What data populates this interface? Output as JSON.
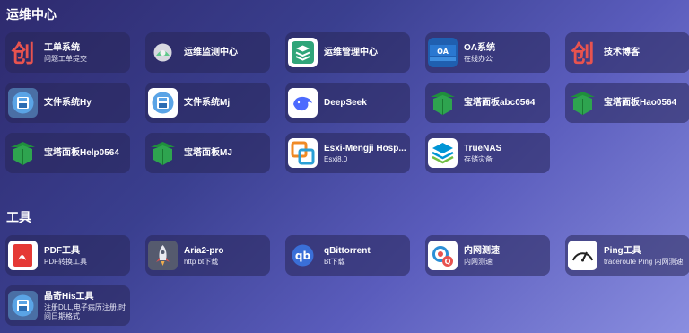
{
  "sections": [
    {
      "title": "运维中心",
      "cards": [
        {
          "name": "工单系统",
          "desc": "问题工单提交",
          "icon": "chuang-logo-icon"
        },
        {
          "name": "运维监测中心",
          "desc": "",
          "icon": "monitor-app-icon"
        },
        {
          "name": "运维管理中心",
          "desc": "",
          "icon": "stack-layers-icon"
        },
        {
          "name": "OA系统",
          "desc": "在线办公",
          "icon": "oa-logo-icon"
        },
        {
          "name": "技术博客",
          "desc": "",
          "icon": "chuang-logo-icon"
        },
        {
          "name": "文件系统Hy",
          "desc": "",
          "icon": "floppy-disk-icon"
        },
        {
          "name": "文件系统Mj",
          "desc": "",
          "icon": "floppy-disk-icon"
        },
        {
          "name": "DeepSeek",
          "desc": "",
          "icon": "whale-icon"
        },
        {
          "name": "宝塔面板abc0564",
          "desc": "",
          "icon": "pagoda-icon"
        },
        {
          "name": "宝塔面板Hao0564",
          "desc": "",
          "icon": "pagoda-icon"
        },
        {
          "name": "宝塔面板Help0564",
          "desc": "",
          "icon": "pagoda-icon"
        },
        {
          "name": "宝塔面板MJ",
          "desc": "",
          "icon": "pagoda-icon"
        },
        {
          "name": "Esxi-Mengji Hosp...",
          "desc": "Esxi8.0",
          "icon": "vmware-icon"
        },
        {
          "name": "TrueNAS",
          "desc": "存储灾备",
          "icon": "truenas-icon"
        }
      ]
    },
    {
      "title": "工具",
      "cards": [
        {
          "name": "PDF工具",
          "desc": "PDF转换工具",
          "icon": "pdf-icon"
        },
        {
          "name": "Aria2-pro",
          "desc": "http bt下载",
          "icon": "rocket-icon"
        },
        {
          "name": "qBittorrent",
          "desc": "Bt下载",
          "icon": "qbittorrent-icon"
        },
        {
          "name": "内网测速",
          "desc": "内网测速",
          "icon": "speedtest-icon"
        },
        {
          "name": "Ping工具",
          "desc": "traceroute Ping 内网测速",
          "icon": "gauge-icon"
        },
        {
          "name": "晶奇His工具",
          "desc": "注册DLL,电子病历注册,时间日期格式",
          "icon": "floppy-disk-icon"
        }
      ]
    }
  ]
}
